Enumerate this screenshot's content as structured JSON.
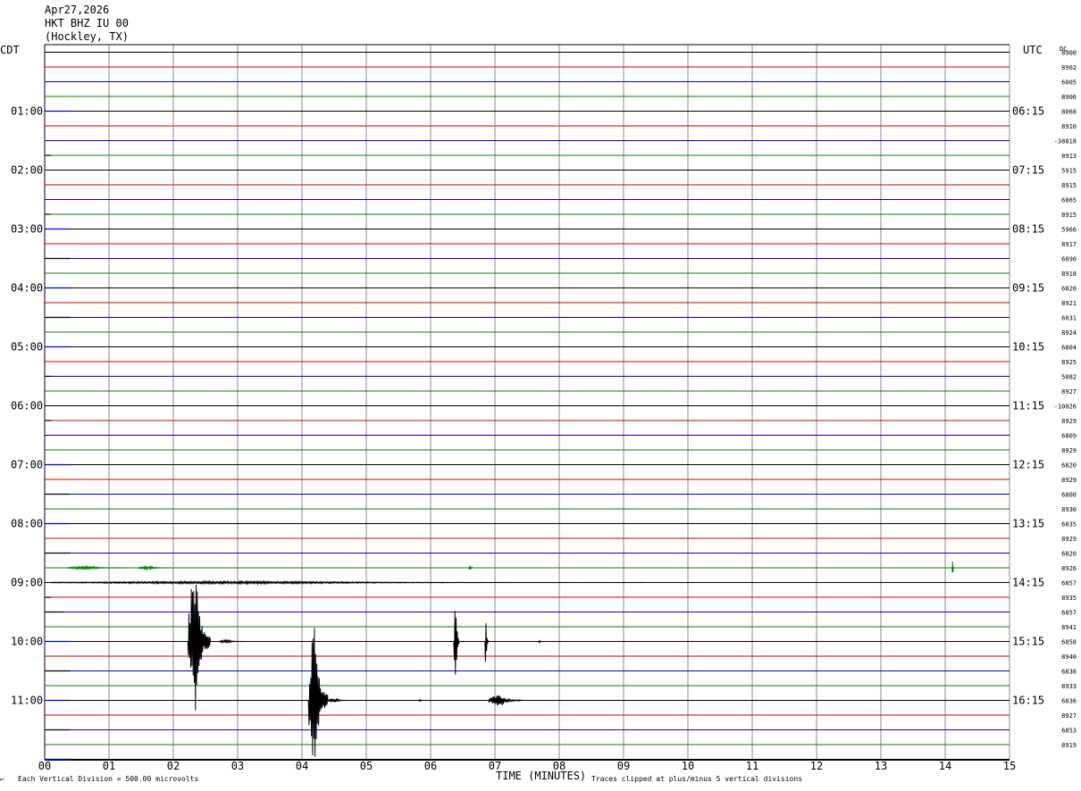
{
  "header": {
    "date": "Apr27,2026",
    "station": "HKT BHZ IU 00",
    "location": "(Hockley, TX)"
  },
  "left_axis_label": "CDT",
  "right_axis_label": "UTC",
  "dc_label": "DC",
  "footer": {
    "division_note": "Each Vertical Division =  500.00 microvolts",
    "x_axis_title": "TIME (MINUTES)",
    "clip_note": "Traces clipped at plus/minus 5 vertical divisions"
  },
  "chart_data": {
    "type": "line",
    "title": "",
    "xlabel": "TIME (MINUTES)",
    "xlim": [
      0,
      15
    ],
    "x_ticks": [
      "00",
      "01",
      "02",
      "03",
      "04",
      "05",
      "06",
      "07",
      "08",
      "09",
      "10",
      "11",
      "12",
      "13",
      "14",
      "15"
    ],
    "row_count": 48,
    "row_colors": [
      "#000000",
      "#cc0000",
      "#0000cc",
      "#008000"
    ],
    "grid": true,
    "cdt_labels": [
      {
        "row": 4,
        "text": "01:00"
      },
      {
        "row": 8,
        "text": "02:00"
      },
      {
        "row": 12,
        "text": "03:00"
      },
      {
        "row": 16,
        "text": "04:00"
      },
      {
        "row": 20,
        "text": "05:00"
      },
      {
        "row": 24,
        "text": "06:00"
      },
      {
        "row": 28,
        "text": "07:00"
      },
      {
        "row": 32,
        "text": "08:00"
      },
      {
        "row": 36,
        "text": "09:00"
      },
      {
        "row": 40,
        "text": "10:00"
      },
      {
        "row": 44,
        "text": "11:00"
      }
    ],
    "utc_labels": [
      {
        "row": 4,
        "text": "06:15"
      },
      {
        "row": 8,
        "text": "07:15"
      },
      {
        "row": 12,
        "text": "08:15"
      },
      {
        "row": 16,
        "text": "09:15"
      },
      {
        "row": 20,
        "text": "10:15"
      },
      {
        "row": 24,
        "text": "11:15"
      },
      {
        "row": 28,
        "text": "12:15"
      },
      {
        "row": 32,
        "text": "13:15"
      },
      {
        "row": 36,
        "text": "14:15"
      },
      {
        "row": 40,
        "text": "15:15"
      },
      {
        "row": 44,
        "text": "16:15"
      }
    ],
    "dc_values": [
      "8900",
      "8902",
      "6005",
      "8906",
      "8068",
      "8910",
      "-38818",
      "8913",
      "5915",
      "8915",
      "6865",
      "8915",
      "5966",
      "8917",
      "6890",
      "8918",
      "6820",
      "8921",
      "6031",
      "8924",
      "6804",
      "8925",
      "5082",
      "8927",
      "-10026",
      "8929",
      "6809",
      "8929",
      "6820",
      "8929",
      "6800",
      "8930",
      "6835",
      "8929",
      "6820",
      "8926",
      "6857",
      "8935",
      "6857",
      "8941",
      "6858",
      "8940",
      "6836",
      "8933",
      "6836",
      "8927",
      "6853",
      "8919"
    ],
    "trace_stubs": [
      {
        "row": 4,
        "x_end": 0.4,
        "color": "#0000cc"
      },
      {
        "row": 7,
        "x_end": 0.1,
        "color": "#000000"
      },
      {
        "row": 11,
        "x_end": 0.1,
        "color": "#000000"
      },
      {
        "row": 12,
        "x_end": 0.4,
        "color": "#0000cc"
      },
      {
        "row": 14,
        "x_end": 0.4,
        "color": "#000000"
      },
      {
        "row": 16,
        "x_end": 0.4,
        "color": "#0000cc"
      },
      {
        "row": 18,
        "x_end": 0.4,
        "color": "#000000"
      },
      {
        "row": 20,
        "x_end": 0.4,
        "color": "#0000cc"
      },
      {
        "row": 22,
        "x_end": 0.1,
        "color": "#000000"
      },
      {
        "row": 25,
        "x_end": 0.1,
        "color": "#000000"
      },
      {
        "row": 28,
        "x_end": 0.4,
        "color": "#0000cc"
      },
      {
        "row": 30,
        "x_end": 0.4,
        "color": "#000000"
      },
      {
        "row": 32,
        "x_end": 0.4,
        "color": "#0000cc"
      },
      {
        "row": 34,
        "x_end": 0.4,
        "color": "#000000"
      },
      {
        "row": 37,
        "x_end": 0.1,
        "color": "#000000"
      },
      {
        "row": 38,
        "x_end": 0.3,
        "color": "#000000"
      },
      {
        "row": 40,
        "x_end": 0.4,
        "color": "#0000cc"
      },
      {
        "row": 42,
        "x_end": 0.4,
        "color": "#000000"
      },
      {
        "row": 44,
        "x_end": 0.4,
        "color": "#0000cc"
      },
      {
        "row": 46,
        "x_end": 0.4,
        "color": "#000000"
      },
      {
        "row": 48,
        "x_end": 0.4,
        "color": "#0000cc"
      }
    ],
    "events": [
      {
        "row": 35,
        "x": 0.8,
        "amp": 0.1,
        "width": 0.9,
        "color": "#008000"
      },
      {
        "row": 35,
        "x": 1.7,
        "amp": 0.1,
        "width": 0.5,
        "color": "#008000"
      },
      {
        "row": 35,
        "x": 6.62,
        "amp": 0.3,
        "width": 0.05,
        "color": "#008000"
      },
      {
        "row": 35,
        "x": 14.12,
        "amp": 0.6,
        "width": 0.03,
        "color": "#008000"
      },
      {
        "row": 36,
        "x": 4.7,
        "amp": 0.08,
        "width": 9.2,
        "color": "#000000"
      },
      {
        "row": 40,
        "x": 2.4,
        "amp": 5.0,
        "width": 0.35,
        "color": "#000000"
      },
      {
        "row": 40,
        "x": 2.9,
        "amp": 0.1,
        "width": 0.4,
        "color": "#000000"
      },
      {
        "row": 40,
        "x": 6.4,
        "amp": 3.4,
        "width": 0.08,
        "color": "#000000"
      },
      {
        "row": 40,
        "x": 6.87,
        "amp": 1.8,
        "width": 0.05,
        "color": "#000000"
      },
      {
        "row": 40,
        "x": 7.7,
        "amp": 0.1,
        "width": 0.05,
        "color": "#000000"
      },
      {
        "row": 44,
        "x": 4.25,
        "amp": 5.0,
        "width": 0.3,
        "color": "#000000"
      },
      {
        "row": 44,
        "x": 4.55,
        "amp": 0.15,
        "width": 0.3,
        "color": "#000000"
      },
      {
        "row": 44,
        "x": 5.85,
        "amp": 0.05,
        "width": 0.1,
        "color": "#000000"
      },
      {
        "row": 44,
        "x": 7.15,
        "amp": 0.4,
        "width": 0.5,
        "color": "#000000"
      }
    ]
  }
}
